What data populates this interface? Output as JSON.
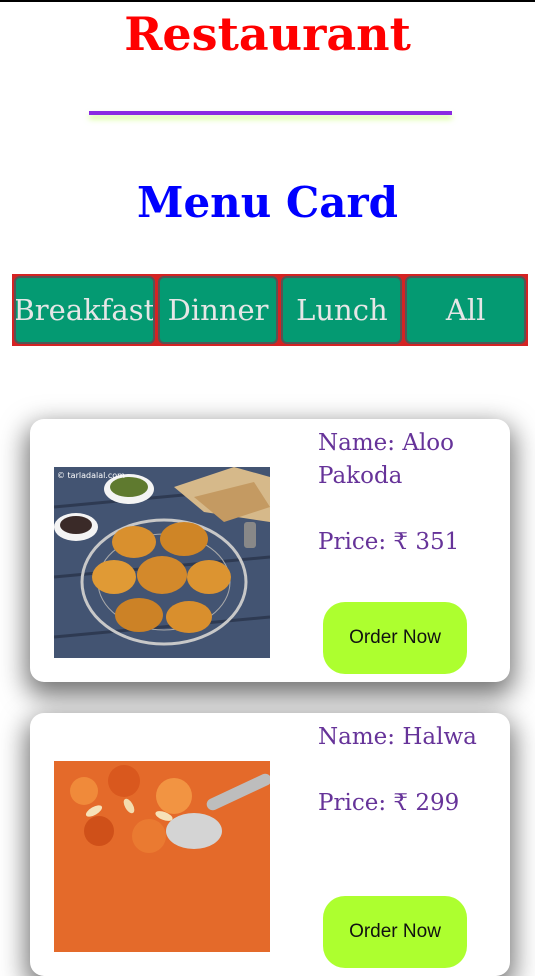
{
  "header": {
    "title": "Restaurant",
    "subtitle": "Menu Card"
  },
  "tabs": [
    {
      "label": "Breakfast"
    },
    {
      "label": "Dinner"
    },
    {
      "label": "Lunch"
    },
    {
      "label": "All"
    }
  ],
  "menu_items": [
    {
      "name_label": "Name:",
      "name": "Aloo Pakoda",
      "price_label": "Price:",
      "currency": "₹",
      "price": "351",
      "order_label": "Order Now",
      "image_watermark": "© tarladalal.com"
    },
    {
      "name_label": "Name:",
      "name": "Halwa",
      "price_label": "Price:",
      "currency": "₹",
      "price": "299",
      "order_label": "Order Now"
    }
  ],
  "colors": {
    "title": "#ff0000",
    "subtitle": "#0000ff",
    "divider": "#8a2be2",
    "tab_bg": "#049a72",
    "tab_bar_bg": "#d42323",
    "item_text": "#663399",
    "order_button": "#adff2f"
  }
}
